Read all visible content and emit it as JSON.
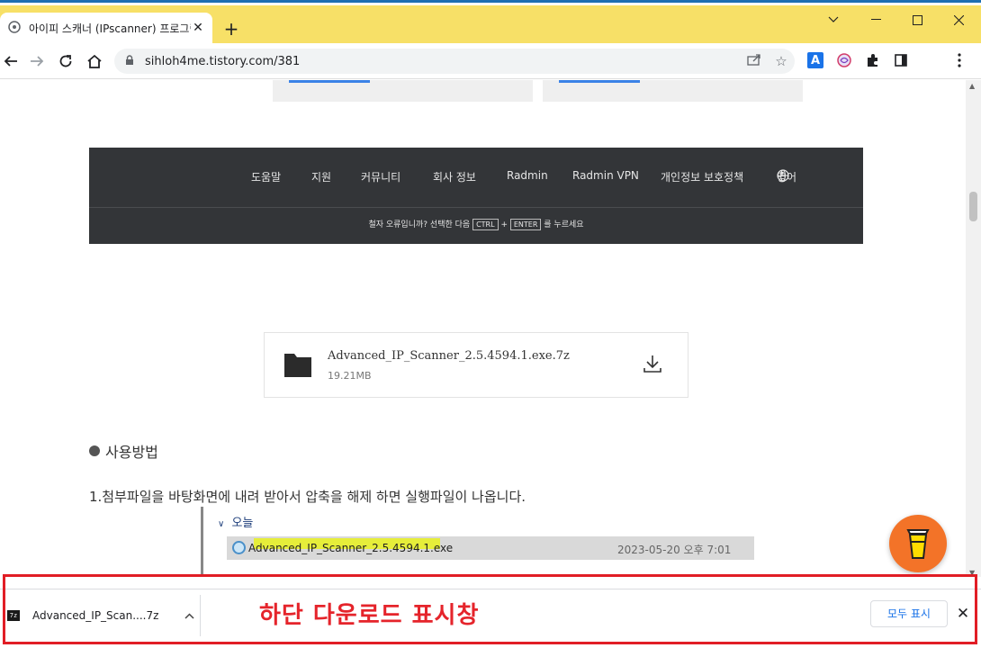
{
  "tab": {
    "title": "아이피 스캐너 (IPscanner) 프로그램"
  },
  "omnibox": {
    "url": "sihloh4me.tistory.com/381"
  },
  "footer": {
    "nav": [
      "도움말",
      "지원",
      "커뮤니티",
      "회사 정보",
      "Radmin",
      "Radmin VPN",
      "개인정보 보호정책"
    ],
    "language": "영어",
    "hint_before": "철자 오류입니까? 선택한 다음",
    "key1": "CTRL",
    "plus": "+",
    "key2": "ENTER",
    "hint_after": "를 누르세요"
  },
  "file_card": {
    "name": "Advanced_IP_Scanner_2.5.4594.1.exe.7z",
    "size": "19.21MB"
  },
  "section_title": "사용방법",
  "paragraph": "1.첨부파일을 바탕화면에 내려 받아서 압축을 해제 하면 실행파일이 나옵니다.",
  "explorer": {
    "group": "오늘",
    "file_name": "Advanced_IP_Scanner_2.5.4594.1.exe",
    "file_date": "2023-05-20 오후 7:01"
  },
  "shelf": {
    "item_icon": "7z",
    "item_name": "Advanced_IP_Scan....7z",
    "annotation": "하단 다운로드 표시창",
    "show_all": "모두 표시"
  },
  "icons": {
    "favicon": "globe-icon",
    "close": "close-icon",
    "new_tab": "plus-icon",
    "back": "back-arrow-icon",
    "forward": "forward-arrow-icon",
    "reload": "reload-icon",
    "home": "home-icon",
    "lock": "lock-icon",
    "share": "share-icon",
    "bookmark": "star-icon",
    "translate": "translate-icon",
    "extension": "puzzle-icon",
    "sidepanel": "side-panel-icon",
    "menu": "kebab-menu-icon",
    "download": "download-icon",
    "folder": "folder-icon",
    "coffee": "coffee-cup-icon"
  },
  "colors": {
    "tabstrip": "#f7e067",
    "annotation_red": "#e11d25",
    "footer_dark": "#333538",
    "coffee_orange": "#f37328"
  }
}
